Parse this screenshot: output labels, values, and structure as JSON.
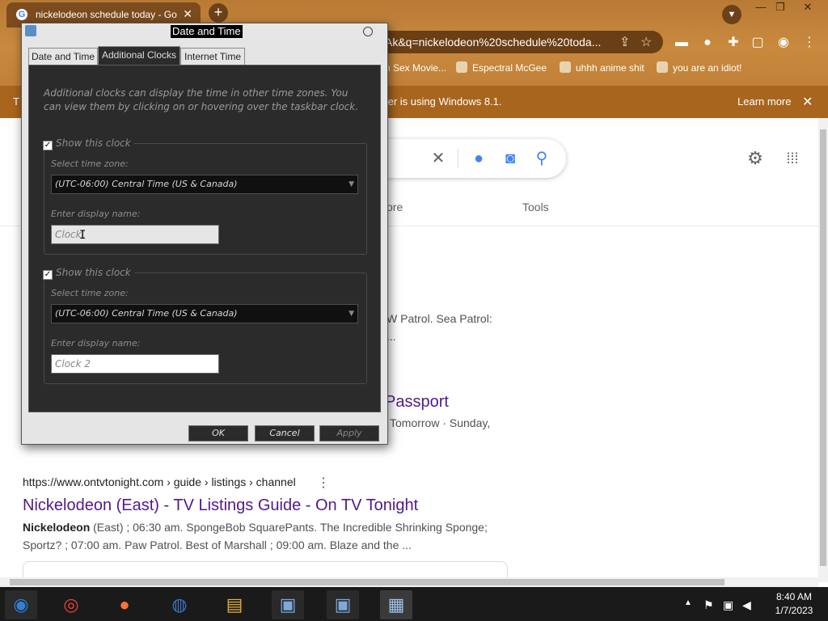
{
  "browser": {
    "tab_title": "nickelodeon schedule today - Goo",
    "tab_close": "✕",
    "new_tab": "+",
    "url_visible": "Ak&q=nickelodeon%20schedule%20toda...",
    "bookmarks": [
      {
        "label": "n Sex Movie..."
      },
      {
        "label": "Espectral McGee"
      },
      {
        "label": "uhhh anime shit"
      },
      {
        "label": "you are an idiot!"
      }
    ],
    "infobar": {
      "message": "ter is using Windows 8.1.",
      "prefix": "T",
      "learn_more": "Learn more",
      "close": "✕"
    },
    "window_controls": {
      "minimize": "—",
      "restore": "❐",
      "close": "✕"
    }
  },
  "google": {
    "tools_label": "Tools",
    "more_label": "ore",
    "results": [
      {
        "snippet_line1": "W Patrol. Sea Patrol:",
        "snippet_line2": "..."
      },
      {
        "title_fragment": "Passport",
        "snippet_fragment": "Tomorrow · Sunday,"
      },
      {
        "cite": "https://www.ontvtonight.com › guide › listings › channel",
        "title": "Nickelodeon (East) - TV Listings Guide - On TV Tonight",
        "snippet_bold": "Nickelodeon",
        "snippet_line1": " (East) ; 06:30 am. SpongeBob SquarePants. The Incredible Shrinking Sponge;",
        "snippet_line2": "Sportz? ; 07:00 am. Paw Patrol. Best of Marshall ; 09:00 am. Blaze and the ..."
      }
    ]
  },
  "dialog": {
    "title": "Date and Time",
    "tabs": [
      "Date and Time",
      "Additional Clocks",
      "Internet Time"
    ],
    "active_tab": "Additional Clocks",
    "description": "Additional clocks can display the time in other time zones. You can view them by clicking on or hovering over the taskbar clock.",
    "clocks": [
      {
        "show_label": "Show this clock",
        "checked": true,
        "tz_label": "Select time zone:",
        "timezone": "(UTC-06:00) Central Time (US & Canada)",
        "name_label": "Enter display name:",
        "display_name": "Clock"
      },
      {
        "show_label": "Show this clock",
        "checked": true,
        "tz_label": "Select time zone:",
        "timezone": "(UTC-06:00) Central Time (US & Canada)",
        "name_label": "Enter display name:",
        "display_name": "Clock 2"
      }
    ],
    "buttons": {
      "ok": "OK",
      "cancel": "Cancel",
      "apply": "Apply"
    }
  },
  "taskbar": {
    "time": "8:40 AM",
    "date": "1/7/2023",
    "apps": [
      "windows-media-center",
      "chrome",
      "firefox",
      "obama-logo",
      "file-explorer",
      "network-app-1",
      "network-app-2",
      "date-time-app"
    ]
  },
  "colors": {
    "chrome_theme": "#b87a35",
    "link_visited": "#52188c",
    "dialog_dark": "#2b2b2b"
  }
}
